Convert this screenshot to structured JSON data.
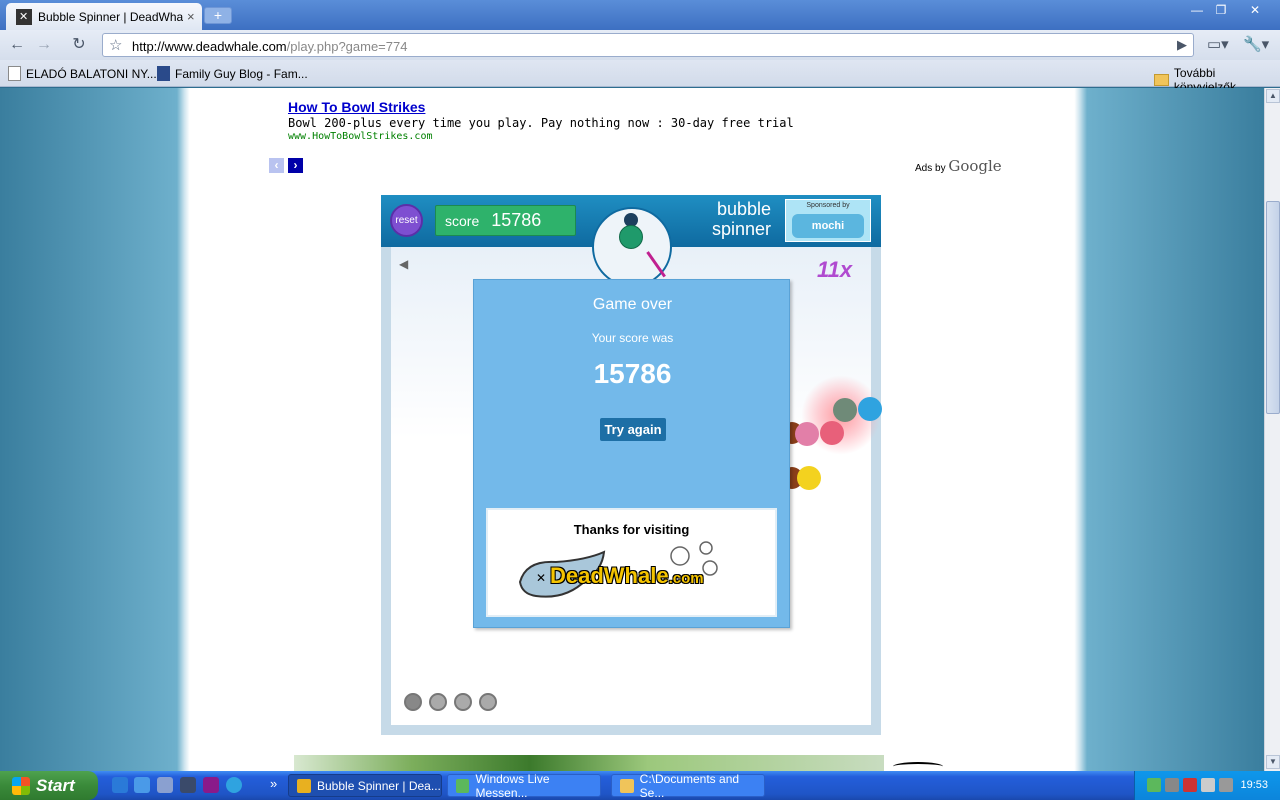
{
  "browser": {
    "tab_title": "Bubble Spinner | DeadWhal...",
    "tab_close": "×",
    "new_tab": "+",
    "url_host": "http://www.deadwhale.com",
    "url_path": "/play.php?game=774",
    "bookmarks": [
      {
        "label": "ELADÓ BALATONI NY...",
        "icon": "page-icon"
      },
      {
        "label": "Family Guy Blog - Fam...",
        "icon": "family-guy-icon"
      }
    ],
    "other_bookmarks": "További könyvjelzők",
    "window_controls": {
      "minimize": "—",
      "maximize": "❐",
      "close": "✕"
    }
  },
  "ad": {
    "title": "How To Bowl Strikes",
    "text": "Bowl 200-plus every time you play. Pay nothing now : 30-day free trial",
    "url": "www.HowToBowlStrikes.com",
    "prev": "‹",
    "next": "›",
    "ads_by": "Ads by",
    "google": "Google"
  },
  "game": {
    "reset_label": "reset",
    "score_label": "score",
    "score_value": "15786",
    "logo_line1": "bubble",
    "logo_line2": "spinner",
    "sponsor_label": "Sponsored by",
    "sponsor_name": "mochi",
    "multiplier": "11x",
    "speaker_icon": "◀",
    "bubbles_colors": {
      "teal": "#1f9a6b",
      "navy": "#1c3f5e",
      "green": "#6f8a78",
      "blue": "#2fa3e0",
      "pink": "#e27fa8",
      "red": "#e8607a",
      "brown": "#8a3f1a",
      "yellow": "#f3d21f"
    },
    "game_over": {
      "title": "Game over",
      "subtitle": "Your score was",
      "score": "15786",
      "button": "Try again",
      "thanks": "Thanks for visiting",
      "logo_main": "DeadWhale",
      "logo_suffix": ".com"
    }
  },
  "taskbar": {
    "start": "Start",
    "tasks": [
      {
        "label": "Bubble Spinner | Dea...",
        "active": true,
        "icon_color": "#e8b020"
      },
      {
        "label": "Windows Live Messen...",
        "active": false,
        "icon_color": "#5cb85c"
      },
      {
        "label": "C:\\Documents and Se...",
        "active": false,
        "icon_color": "#f0c45a"
      }
    ],
    "overflow": "»",
    "clock": "19:53"
  }
}
